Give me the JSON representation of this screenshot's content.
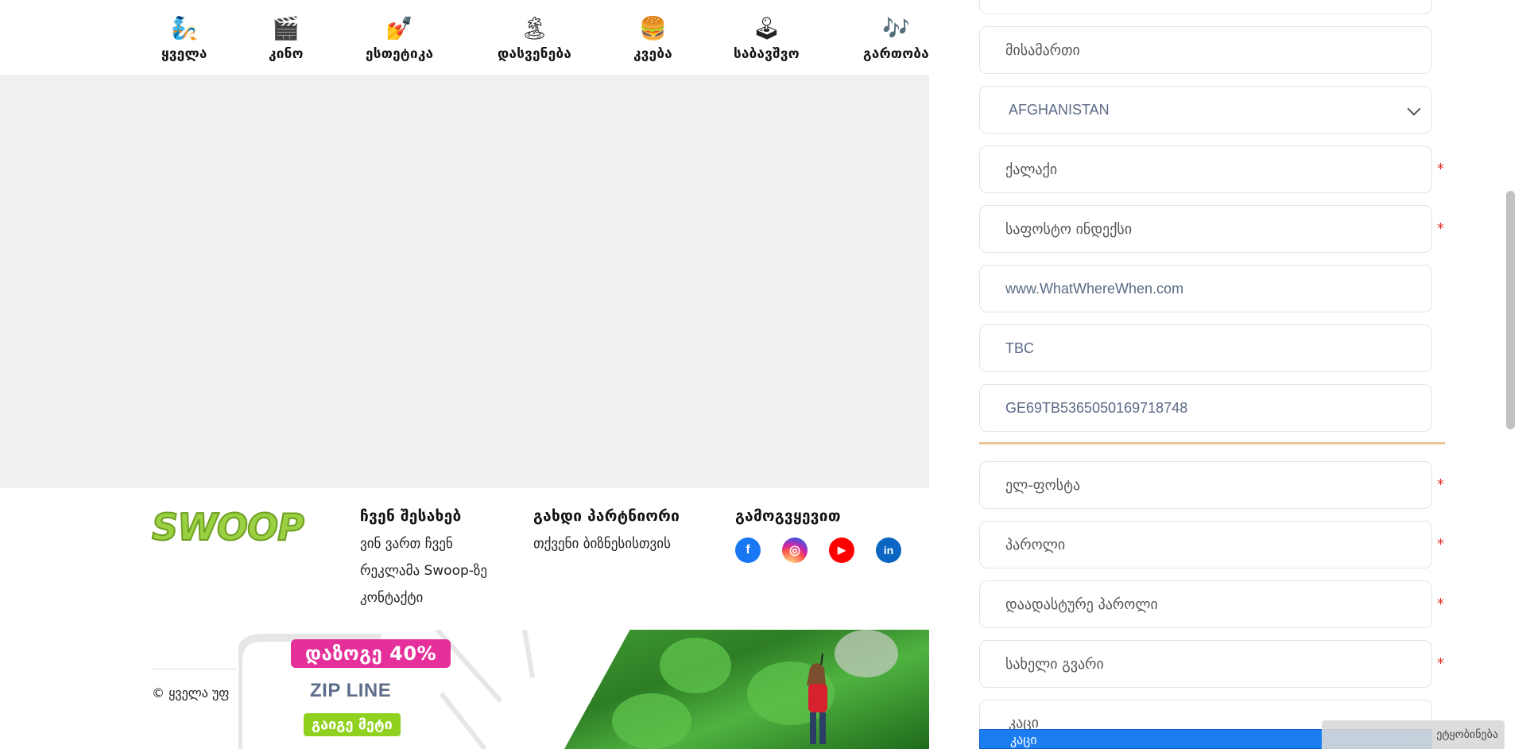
{
  "categories": [
    {
      "icon": "🧞",
      "icon_name": "genie-icon",
      "label": "ყველა"
    },
    {
      "icon": "🎬",
      "icon_name": "clapperboard-icon",
      "label": "კინო"
    },
    {
      "icon": "💅",
      "icon_name": "nail-polish-icon",
      "label": "ესთეტიკა"
    },
    {
      "icon": "🏝",
      "icon_name": "island-icon",
      "label": "დასვენება"
    },
    {
      "icon": "🍔",
      "icon_name": "burger-icon",
      "label": "კვება"
    },
    {
      "icon": "🕹",
      "icon_name": "joystick-icon",
      "label": "საბავშვო"
    },
    {
      "icon": "🎶",
      "icon_name": "music-notes-icon",
      "label": "გართობა"
    }
  ],
  "footer": {
    "logo": "SWOOP",
    "about": {
      "title": "ჩვენ შესახებ",
      "links": [
        "ვინ ვართ ჩვენ",
        "რეკლამა Swoop-ზე",
        "კონტაქტი"
      ]
    },
    "partner": {
      "title": "გახდი პარტნიორი",
      "links": [
        "თქვენი ბიზნესისთვის"
      ]
    },
    "follow": {
      "title": "გამოგვყევით",
      "icons": [
        {
          "name": "facebook-icon",
          "glyph": "f",
          "color": "#1877f2"
        },
        {
          "name": "instagram-icon",
          "glyph": "◎",
          "color": "#d62976"
        },
        {
          "name": "youtube-icon",
          "glyph": "▶",
          "color": "#ff0000"
        },
        {
          "name": "linkedin-icon",
          "glyph": "in",
          "color": "#0a66c2"
        }
      ]
    },
    "copyright": "© ყველა უფ"
  },
  "banner": {
    "promo": "დაზოგე 40%",
    "product": "ZIP LINE",
    "cta": "გაიგე მეტი"
  },
  "form": {
    "address_placeholder": "მისამართი",
    "country": "AFGHANISTAN",
    "city_placeholder": "ქალაქი",
    "postal_placeholder": "საფოსტო ინდექსი",
    "website": "www.WhatWhereWhen.com",
    "bank": "TBC",
    "iban": "GE69TB5365050169718748",
    "email_placeholder": "ელ-ფოსტა",
    "password_placeholder": "პაროლი",
    "confirm_placeholder": "დაადასტურე პაროლი",
    "fullname_placeholder": "სახელი გვარი",
    "gender": "კაცი",
    "gender_option": "კაცი",
    "required_mark": "*"
  },
  "toast": "ეტყობინება",
  "colors": {
    "brand_green": "#9bd042",
    "promo_pink": "#e52f9b",
    "cta_green": "#8fd11e",
    "divider_orange": "#f0c49a",
    "dropdown_blue": "#1a7df2"
  }
}
